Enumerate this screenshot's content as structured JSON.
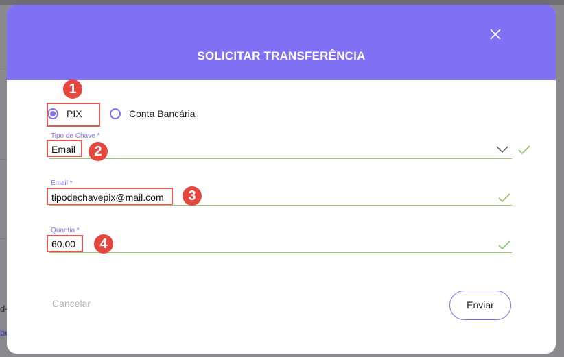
{
  "modal": {
    "title": "SOLICITAR TRANSFERÊNCIA",
    "header_color": "#8070f3"
  },
  "transfer_type": {
    "options": [
      {
        "label": "PIX",
        "selected": true
      },
      {
        "label": "Conta Bancária",
        "selected": false
      }
    ]
  },
  "fields": {
    "key_type": {
      "label": "Tipo de Chave *",
      "value": "Email",
      "valid": true
    },
    "email": {
      "label": "Email *",
      "value": "tipodechavepix@mail.com",
      "valid": true
    },
    "amount": {
      "label": "Quantia *",
      "value": "60.00",
      "valid": true
    }
  },
  "actions": {
    "cancel_label": "Cancelar",
    "submit_label": "Enviar"
  },
  "annotations": {
    "badges": [
      "1",
      "2",
      "3",
      "4"
    ],
    "color": "#e5473e"
  },
  "background": {
    "fragments": [
      "d-",
      "be"
    ]
  },
  "icons": {
    "close": "close-icon",
    "dropdown": "chevron-down-icon",
    "valid": "check-icon"
  }
}
